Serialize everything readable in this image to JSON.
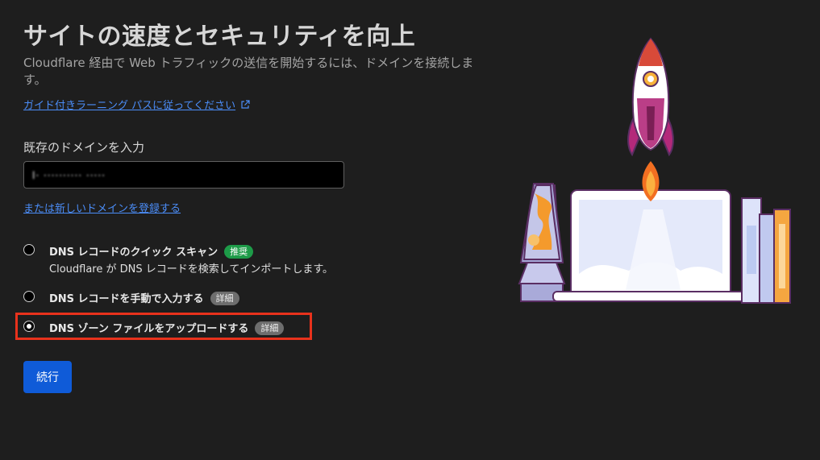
{
  "header": {
    "title": "サイトの速度とセキュリティを向上",
    "subtitle": "Cloudflare 経由で Web トラフィックの送信を開始するには、ドメインを接続します。",
    "guide_link": "ガイド付きラーニング パスに従ってください"
  },
  "domain": {
    "label": "既存のドメインを入力",
    "value": "l·  ··········  ·····",
    "register_link": "または新しいドメインを登録する"
  },
  "options": [
    {
      "label": "DNS レコードのクイック スキャン",
      "badge": "推奨",
      "description": "Cloudflare が DNS レコードを検索してインポートします。",
      "selected": false
    },
    {
      "label": "DNS レコードを手動で入力する",
      "badge": "詳細",
      "selected": false
    },
    {
      "label": "DNS ゾーン ファイルをアップロードする",
      "badge": "詳細",
      "selected": true
    }
  ],
  "continue_button": "続行",
  "colors": {
    "background": "#1e1e1e",
    "link": "#4b8df8",
    "primary_button": "#0f5bd8",
    "recommended_badge": "#1d9b48",
    "highlight": "#e8321c"
  },
  "icons": [
    "external-link-icon",
    "rocket-illustration",
    "laptop-illustration",
    "lava-lamp-illustration",
    "books-illustration"
  ]
}
